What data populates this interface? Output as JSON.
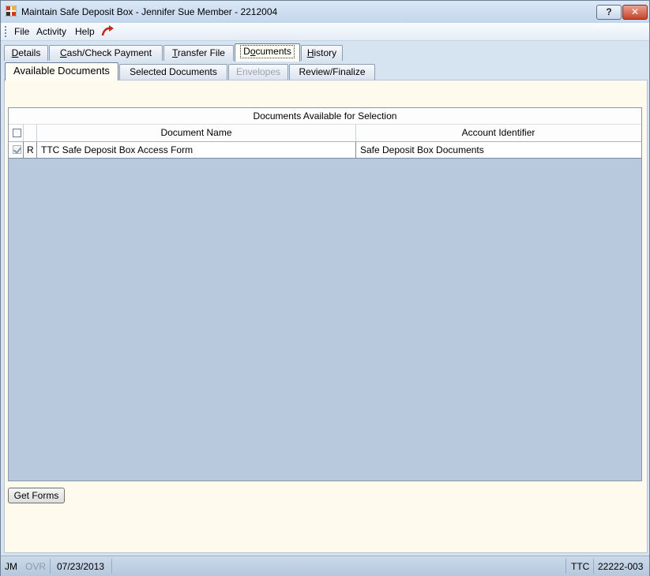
{
  "window": {
    "title": "Maintain Safe Deposit Box - Jennifer Sue Member - 2212004",
    "help_button": "?",
    "close_button": "✕"
  },
  "menu": {
    "items": [
      "File",
      "Activity",
      "Help"
    ],
    "back_icon": "curved-arrow-icon"
  },
  "tabs": {
    "primary": [
      {
        "label": "Details",
        "ul": "D",
        "rest": "etails"
      },
      {
        "label": "Cash/Check Payment",
        "ul": "C",
        "rest": "ash/Check Payment"
      },
      {
        "label": "Transfer File",
        "ul": "T",
        "rest": "ransfer File"
      },
      {
        "label": "Documents",
        "ul": "o",
        "pre": "D",
        "rest": "cuments"
      },
      {
        "label": "History",
        "ul": "H",
        "rest": "istory"
      }
    ],
    "secondary": [
      "Available Documents",
      "Selected Documents",
      "Envelopes",
      "Review/Finalize"
    ]
  },
  "grid": {
    "title": "Documents Available for Selection",
    "columns": [
      "Document Name",
      "Account Identifier"
    ],
    "rows": [
      {
        "checked": true,
        "flag": "R",
        "document_name": "TTC Safe Deposit Box Access Form",
        "account_identifier": "Safe Deposit Box Documents"
      }
    ]
  },
  "buttons": {
    "get_forms": "Get Forms"
  },
  "status": {
    "user": "JM",
    "ovr": "OVR",
    "date": "07/23/2013",
    "inst": "TTC",
    "terminal": "22222-003"
  }
}
